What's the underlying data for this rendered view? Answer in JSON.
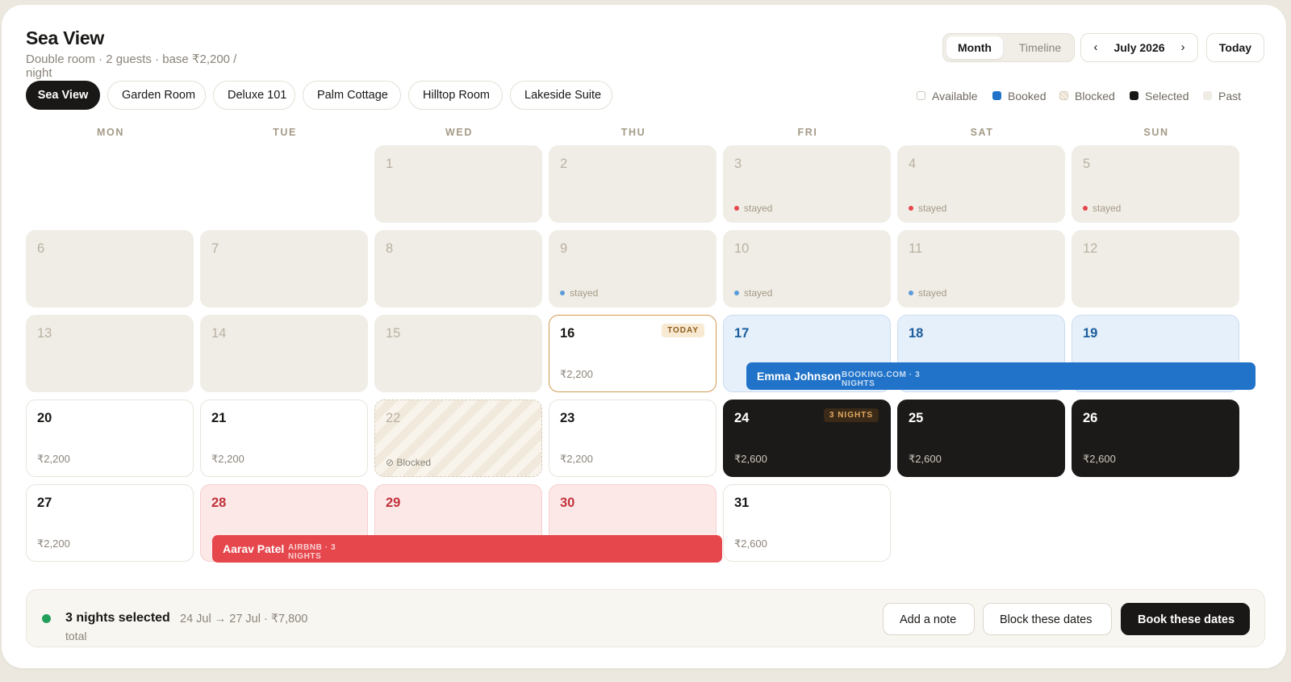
{
  "header": {
    "title": "Sea View",
    "subtitle": "Double room · 2 guests · base ₹2,200 / night"
  },
  "view_toggle": {
    "month": "Month",
    "timeline": "Timeline",
    "active": "Month"
  },
  "month_nav": {
    "prev_icon": "chevron-left-icon",
    "prev": "‹",
    "label": "July 2026",
    "next_icon": "chevron-right-icon",
    "next": "›"
  },
  "today_button": "Today",
  "properties": [
    "Sea View",
    "Garden Room",
    "Deluxe 101",
    "Palm Cottage",
    "Hilltop Room",
    "Lakeside Suite"
  ],
  "active_property": "Sea View",
  "legend": [
    {
      "label": "Available",
      "color": "#ffffff"
    },
    {
      "label": "Booked",
      "color": "#2173c9"
    },
    {
      "label": "Blocked",
      "color": "#eadfcd"
    },
    {
      "label": "Selected",
      "color": "#1a1816"
    },
    {
      "label": "Past",
      "color": "#efece5"
    }
  ],
  "weekdays": [
    "MON",
    "TUE",
    "WED",
    "THU",
    "FRI",
    "SAT",
    "SUN"
  ],
  "days": [
    {
      "day": "1",
      "state": "past"
    },
    {
      "day": "2",
      "state": "past"
    },
    {
      "day": "3",
      "state": "past",
      "note": "stayed",
      "dot": "#e5474d"
    },
    {
      "day": "4",
      "state": "past",
      "note": "stayed",
      "dot": "#e5474d"
    },
    {
      "day": "5",
      "state": "past",
      "note": "stayed",
      "dot": "#e5474d"
    },
    {
      "day": "6",
      "state": "past"
    },
    {
      "day": "7",
      "state": "past"
    },
    {
      "day": "8",
      "state": "past"
    },
    {
      "day": "9",
      "state": "past",
      "note": "stayed",
      "dot": "#5b9bd8"
    },
    {
      "day": "10",
      "state": "past",
      "note": "stayed",
      "dot": "#5b9bd8"
    },
    {
      "day": "11",
      "state": "past",
      "note": "stayed",
      "dot": "#5b9bd8"
    },
    {
      "day": "12",
      "state": "past"
    },
    {
      "day": "13",
      "state": "past"
    },
    {
      "day": "14",
      "state": "past"
    },
    {
      "day": "15",
      "state": "past"
    },
    {
      "day": "16",
      "state": "today",
      "price": "₹2,200",
      "badge": "TODAY"
    },
    {
      "day": "17",
      "state": "booked-blue"
    },
    {
      "day": "18",
      "state": "booked-blue"
    },
    {
      "day": "19",
      "state": "booked-blue"
    },
    {
      "day": "20",
      "state": "available",
      "price": "₹2,200"
    },
    {
      "day": "21",
      "state": "available",
      "price": "₹2,200"
    },
    {
      "day": "22",
      "state": "blocked",
      "note": "Blocked"
    },
    {
      "day": "23",
      "state": "available",
      "price": "₹2,200"
    },
    {
      "day": "24",
      "state": "selected",
      "price": "₹2,600",
      "badge": "3 NIGHTS"
    },
    {
      "day": "25",
      "state": "selected",
      "price": "₹2,600"
    },
    {
      "day": "26",
      "state": "selected",
      "price": "₹2,600"
    },
    {
      "day": "27",
      "state": "available",
      "price": "₹2,200"
    },
    {
      "day": "28",
      "state": "booked-red"
    },
    {
      "day": "29",
      "state": "booked-red"
    },
    {
      "day": "30",
      "state": "booked-red"
    },
    {
      "day": "31",
      "state": "available",
      "price": "₹2,600"
    }
  ],
  "bookings": [
    {
      "guest": "Emma Johnson",
      "meta": "BOOKING.COM · 3 NIGHTS",
      "color": "#2173c9"
    },
    {
      "guest": "Aarav Patel",
      "meta": "AIRBNB · 3 NIGHTS",
      "color": "#e5474d"
    }
  ],
  "footer": {
    "selected": "3 nights selected",
    "range": "24 Jul → 27 Jul · ₹7,800",
    "total": "total",
    "add_note": "Add a note",
    "block": "Block these dates",
    "book": "Book these dates"
  }
}
